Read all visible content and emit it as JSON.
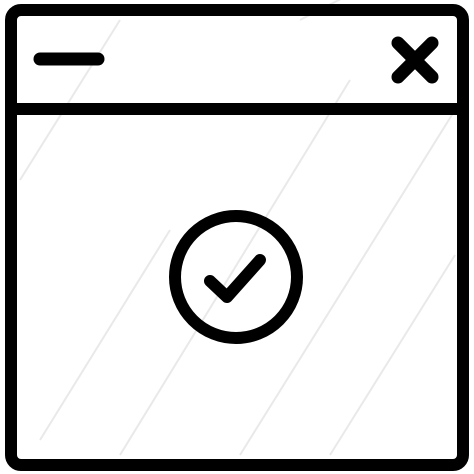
{
  "window": {
    "stroke_color": "#000000",
    "background_color": "#ffffff",
    "titlebar": {
      "left_control_icon": "minimize-icon",
      "right_control_icon": "close-icon"
    },
    "content": {
      "status_icon": "check-circle-icon"
    }
  }
}
